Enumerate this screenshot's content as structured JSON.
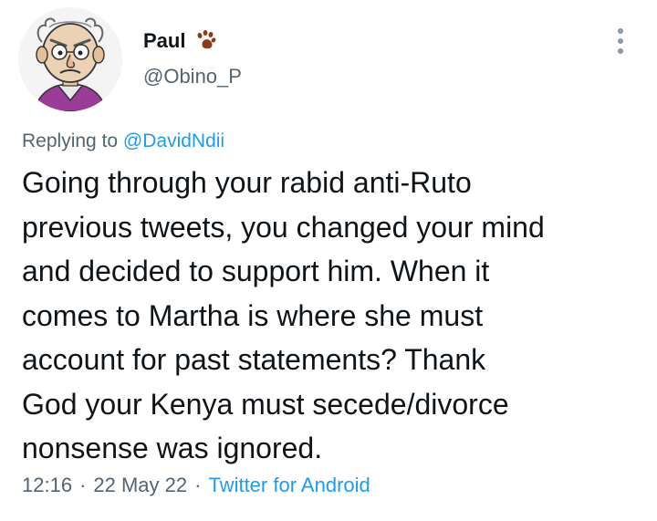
{
  "author": {
    "display_name": "Paul",
    "handle": "@Obino_P",
    "badge_icon": "paw-print-icon"
  },
  "reply": {
    "prefix": "Replying to",
    "mention": "@DavidNdii"
  },
  "tweet": {
    "lines": [
      "Going through your rabid anti-Ruto",
      "previous tweets, you changed your mind",
      "and decided to support him. When it",
      "comes to Martha is where she must",
      "account for past statements? Thank",
      "God your Kenya must secede/divorce",
      "nonsense was ignored."
    ]
  },
  "meta": {
    "time": "12:16",
    "date": "22 May 22",
    "separator": "·",
    "source": "Twitter for Android"
  },
  "colors": {
    "primary_text": "#0f1419",
    "secondary_text": "#536471",
    "link": "#1d9bf0",
    "paw": "#8b3a1a"
  }
}
